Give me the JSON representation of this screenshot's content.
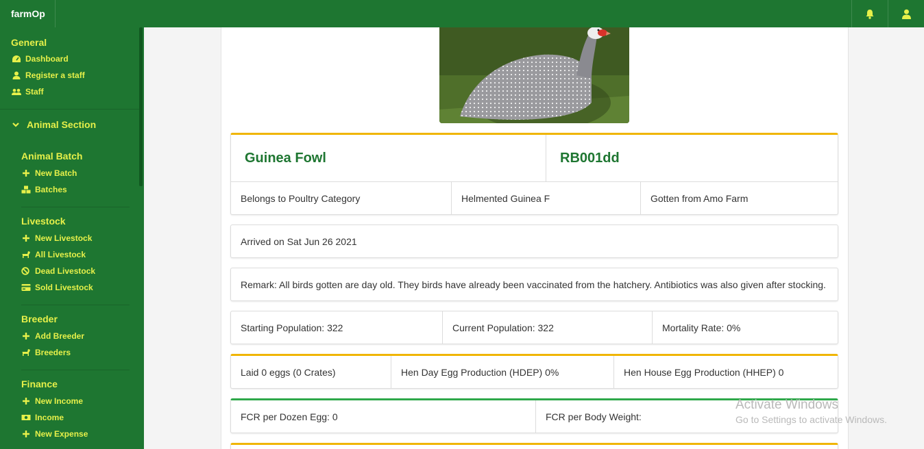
{
  "app": {
    "brand": "farmOp"
  },
  "header": {
    "icons": [
      "bell-icon",
      "user-icon"
    ]
  },
  "sidebar": {
    "general": {
      "heading": "General",
      "items": [
        {
          "label": "Dashboard",
          "icon": "dashboard-icon"
        },
        {
          "label": "Register a staff",
          "icon": "user-icon"
        },
        {
          "label": "Staff",
          "icon": "users-icon"
        }
      ]
    },
    "animal_section": {
      "heading": "Animal Section",
      "icon": "chevron-down-icon"
    },
    "animal_batch": {
      "heading": "Animal Batch",
      "items": [
        {
          "label": "New Batch",
          "icon": "plus-icon"
        },
        {
          "label": "Batches",
          "icon": "boxes-icon"
        }
      ]
    },
    "livestock": {
      "heading": "Livestock",
      "items": [
        {
          "label": "New Livestock",
          "icon": "plus-icon"
        },
        {
          "label": "All Livestock",
          "icon": "horse-icon"
        },
        {
          "label": "Dead Livestock",
          "icon": "ban-icon"
        },
        {
          "label": "Sold Livestock",
          "icon": "card-icon"
        }
      ]
    },
    "breeder": {
      "heading": "Breeder",
      "items": [
        {
          "label": "Add Breeder",
          "icon": "plus-icon"
        },
        {
          "label": "Breeders",
          "icon": "horse-icon"
        }
      ]
    },
    "finance": {
      "heading": "Finance",
      "items": [
        {
          "label": "New Income",
          "icon": "plus-icon"
        },
        {
          "label": "Income",
          "icon": "money-icon"
        },
        {
          "label": "New Expense",
          "icon": "plus-icon"
        }
      ]
    }
  },
  "batch": {
    "name": "Guinea Fowl",
    "code": "RB001dd",
    "category": "Belongs to Poultry Category",
    "breed": "Helmented Guinea F",
    "source": "Gotten from Amo Farm",
    "arrived": "Arrived on Sat Jun 26 2021",
    "remark": "Remark: All birds gotten are day old. They birds have already been vaccinated from the hatchery. Antibiotics was also given after stocking.",
    "starting_population": "Starting Population: 322",
    "current_population": "Current Population: 322",
    "mortality_rate": "Mortality Rate: 0%",
    "eggs_laid": "Laid 0 eggs (0 Crates)",
    "hdep": "Hen Day Egg Production (HDEP) 0%",
    "hhep": "Hen House Egg Production (HHEP) 0",
    "fcr_egg": "FCR per Dozen Egg: 0",
    "fcr_weight": "FCR per Body Weight:"
  },
  "watermark": {
    "line1": "Activate Windows",
    "line2": "Go to Settings to activate Windows."
  },
  "colors": {
    "primary": "#1e7631",
    "accent": "#e6f04a",
    "gold": "#f0b500",
    "green_border": "#2ea84a"
  }
}
